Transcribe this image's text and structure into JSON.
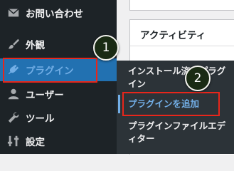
{
  "sidebar": {
    "items": [
      {
        "label": "お問い合わせ",
        "icon": "envelope-icon"
      },
      {
        "label": "外観",
        "icon": "brush-icon"
      },
      {
        "label": "プラグイン",
        "icon": "plugin-icon",
        "current": true
      },
      {
        "label": "ユーザー",
        "icon": "user-icon"
      },
      {
        "label": "ツール",
        "icon": "wrench-icon"
      },
      {
        "label": "設定",
        "icon": "settings-icon"
      }
    ]
  },
  "main": {
    "card_title": "アクティビティ"
  },
  "submenu": {
    "items": [
      {
        "label": "インストール済みプラグイン"
      },
      {
        "label": "プラグインを追加",
        "active": true
      },
      {
        "label": "プラグインファイルエディター"
      }
    ]
  },
  "annotations": {
    "badge1": "1",
    "badge2": "2",
    "highlight_color": "#e8261b"
  },
  "colors": {
    "sidebar_bg": "#1d2327",
    "submenu_bg": "#2c3338",
    "accent": "#72aee6",
    "current_bg": "#2271b1"
  }
}
